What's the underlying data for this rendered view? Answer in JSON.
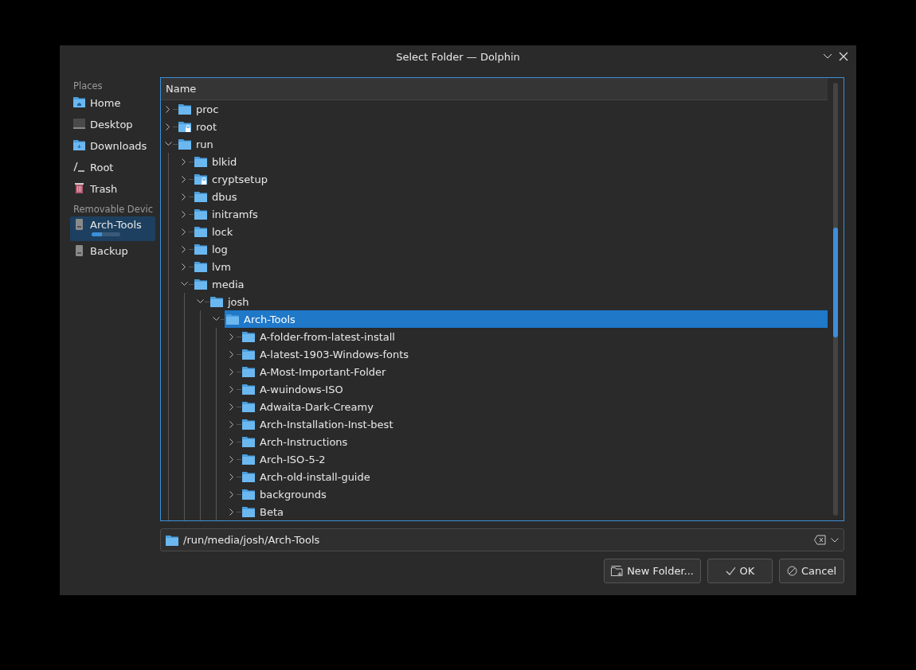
{
  "window": {
    "title": "Select Folder — Dolphin"
  },
  "places": {
    "sections": [
      {
        "title": "Places",
        "items": [
          {
            "label": "Home",
            "kind": "home",
            "selected": false
          },
          {
            "label": "Desktop",
            "kind": "desktop",
            "selected": false
          },
          {
            "label": "Downloads",
            "kind": "downloads",
            "selected": false
          },
          {
            "label": "Root",
            "kind": "root",
            "selected": false
          },
          {
            "label": "Trash",
            "kind": "trash",
            "selected": false
          }
        ]
      },
      {
        "title": "Removable Devic",
        "items": [
          {
            "label": "Arch-Tools",
            "kind": "drive",
            "selected": true,
            "level": 0.35
          },
          {
            "label": "Backup",
            "kind": "drive",
            "selected": false
          }
        ]
      }
    ]
  },
  "tree": {
    "column": "Name",
    "items": [
      {
        "name": "proc",
        "expanded": false,
        "locked": false,
        "selected": false
      },
      {
        "name": "root",
        "expanded": false,
        "locked": true,
        "selected": false
      },
      {
        "name": "run",
        "expanded": true,
        "locked": false,
        "selected": false,
        "children": [
          {
            "name": "blkid",
            "expanded": false,
            "locked": false,
            "selected": false
          },
          {
            "name": "cryptsetup",
            "expanded": false,
            "locked": true,
            "selected": false
          },
          {
            "name": "dbus",
            "expanded": false,
            "locked": false,
            "selected": false
          },
          {
            "name": "initramfs",
            "expanded": false,
            "locked": false,
            "selected": false
          },
          {
            "name": "lock",
            "expanded": false,
            "locked": false,
            "selected": false
          },
          {
            "name": "log",
            "expanded": false,
            "locked": false,
            "selected": false
          },
          {
            "name": "lvm",
            "expanded": false,
            "locked": false,
            "selected": false
          },
          {
            "name": "media",
            "expanded": true,
            "locked": false,
            "selected": false,
            "children": [
              {
                "name": "josh",
                "expanded": true,
                "locked": false,
                "selected": false,
                "children": [
                  {
                    "name": "Arch-Tools",
                    "expanded": true,
                    "locked": false,
                    "selected": true,
                    "children": [
                      {
                        "name": "A-folder-from-latest-install",
                        "expanded": false,
                        "locked": false,
                        "selected": false
                      },
                      {
                        "name": "A-latest-1903-Windows-fonts",
                        "expanded": false,
                        "locked": false,
                        "selected": false
                      },
                      {
                        "name": "A-Most-Important-Folder",
                        "expanded": false,
                        "locked": false,
                        "selected": false
                      },
                      {
                        "name": "A-wuindows-ISO",
                        "expanded": false,
                        "locked": false,
                        "selected": false
                      },
                      {
                        "name": "Adwaita-Dark-Creamy",
                        "expanded": false,
                        "locked": false,
                        "selected": false
                      },
                      {
                        "name": "Arch-Installation-Inst-best",
                        "expanded": false,
                        "locked": false,
                        "selected": false
                      },
                      {
                        "name": "Arch-Instructions",
                        "expanded": false,
                        "locked": false,
                        "selected": false
                      },
                      {
                        "name": "Arch-ISO-5-2",
                        "expanded": false,
                        "locked": false,
                        "selected": false
                      },
                      {
                        "name": "Arch-old-install-guide",
                        "expanded": false,
                        "locked": false,
                        "selected": false
                      },
                      {
                        "name": "backgrounds",
                        "expanded": false,
                        "locked": false,
                        "selected": false
                      },
                      {
                        "name": "Beta",
                        "expanded": false,
                        "locked": false,
                        "selected": false
                      }
                    ]
                  }
                ]
              }
            ]
          }
        ]
      }
    ]
  },
  "path_field": {
    "value": "/run/media/josh/Arch-Tools"
  },
  "buttons": [
    {
      "label": "New Folder...",
      "kind": "new-folder"
    },
    {
      "label": "OK",
      "kind": "ok"
    },
    {
      "label": "Cancel",
      "kind": "cancel"
    }
  ]
}
